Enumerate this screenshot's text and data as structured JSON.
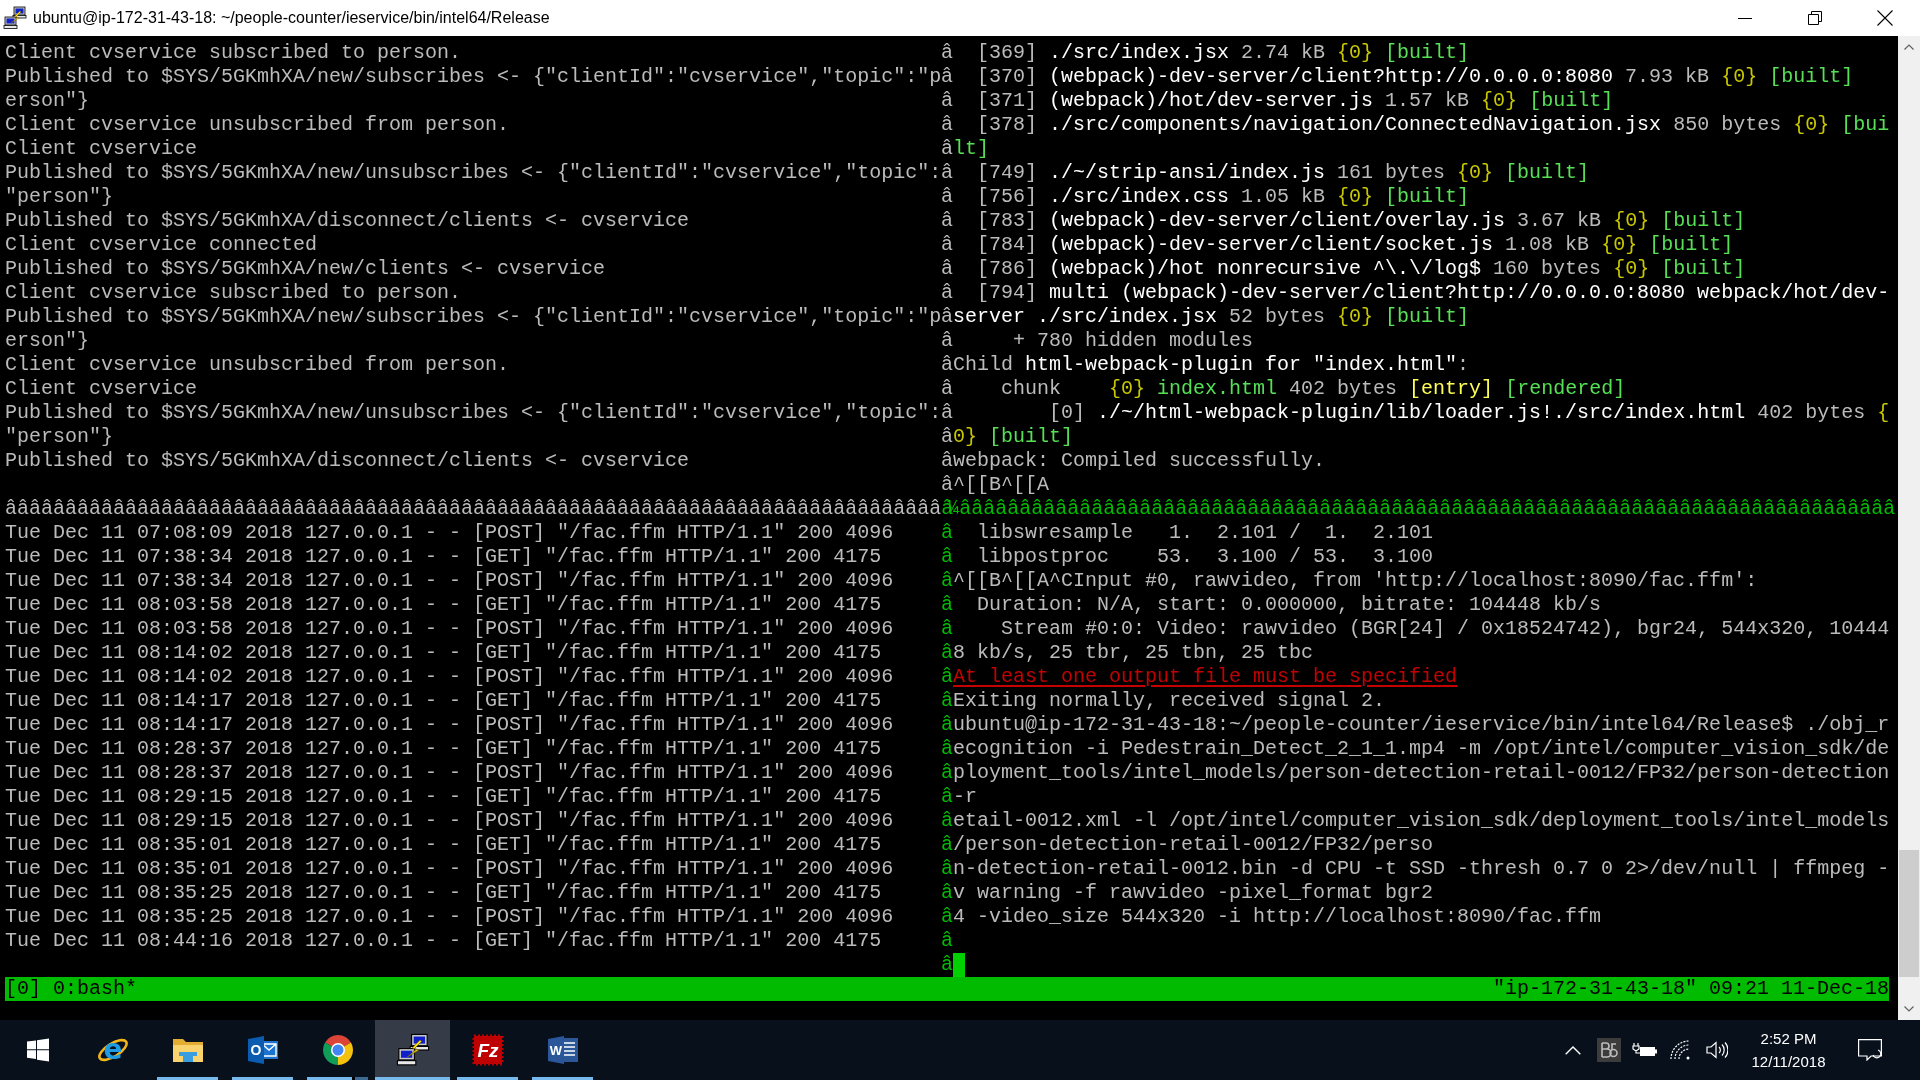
{
  "window": {
    "title": "ubuntu@ip-172-31-43-18: ~/people-counter/ieservice/bin/intel64/Release"
  },
  "terminal": {
    "top": {
      "border_active": false,
      "rows": [
        {
          "left": "Client cvservice subscribed to person.",
          "divider": "â",
          "right": [
            "  [369] ",
            {
              "text": "./src/index.jsx",
              "kind": "module"
            },
            " 2.74 kB ",
            {
              "text": "{0}",
              "kind": "chunk"
            },
            {
              "text": " [built]",
              "kind": "status"
            }
          ]
        },
        {
          "left": "Published to $SYS/5GKmhXA/new/subscribes <- {\"clientId\":\"cvservice\",\"topic\":\"p",
          "divider": "â",
          "right": [
            "  [370] ",
            {
              "text": "(webpack)-dev-server/client?http://0.0.0.0:8080",
              "kind": "module"
            },
            " 7.93 kB ",
            {
              "text": "{0}",
              "kind": "chunk"
            },
            {
              "text": " [built]",
              "kind": "status"
            }
          ]
        },
        {
          "left": "erson\"}",
          "divider": "â",
          "right": [
            "  [371] ",
            {
              "text": "(webpack)/hot/dev-server.js",
              "kind": "module"
            },
            " 1.57 kB ",
            {
              "text": "{0}",
              "kind": "chunk"
            },
            {
              "text": " [built]",
              "kind": "status"
            }
          ]
        },
        {
          "left": "Client cvservice unsubscribed from person.",
          "divider": "â",
          "right": [
            "  [378] ",
            {
              "text": "./src/components/navigation/ConnectedNavigation.jsx",
              "kind": "module"
            },
            " 850 bytes ",
            {
              "text": "{0}",
              "kind": "chunk"
            },
            {
              "text": " [bui",
              "kind": "status"
            }
          ]
        },
        {
          "left": "Client cvservice",
          "divider": "â",
          "right": [
            {
              "text": "lt]",
              "kind": "status"
            }
          ]
        },
        {
          "left": "Published to $SYS/5GKmhXA/new/unsubscribes <- {\"clientId\":\"cvservice\",\"topic\":",
          "divider": "â",
          "right": [
            "  [749] ",
            {
              "text": "./~/strip-ansi/index.js",
              "kind": "module"
            },
            " 161 bytes ",
            {
              "text": "{0}",
              "kind": "chunk"
            },
            {
              "text": " [built]",
              "kind": "status"
            }
          ]
        },
        {
          "left": "\"person\"}",
          "divider": "â",
          "right": [
            "  [756] ",
            {
              "text": "./src/index.css",
              "kind": "module"
            },
            " 1.05 kB ",
            {
              "text": "{0}",
              "kind": "chunk"
            },
            {
              "text": " [built]",
              "kind": "status"
            }
          ]
        },
        {
          "left": "Published to $SYS/5GKmhXA/disconnect/clients <- cvservice",
          "divider": "â",
          "right": [
            "  [783] ",
            {
              "text": "(webpack)-dev-server/client/overlay.js",
              "kind": "module"
            },
            " 3.67 kB ",
            {
              "text": "{0}",
              "kind": "chunk"
            },
            {
              "text": " [built]",
              "kind": "status"
            }
          ]
        },
        {
          "left": "Client cvservice connected",
          "divider": "â",
          "right": [
            "  [784] ",
            {
              "text": "(webpack)-dev-server/client/socket.js",
              "kind": "module"
            },
            " 1.08 kB ",
            {
              "text": "{0}",
              "kind": "chunk"
            },
            {
              "text": " [built]",
              "kind": "status"
            }
          ]
        },
        {
          "left": "Published to $SYS/5GKmhXA/new/clients <- cvservice",
          "divider": "â",
          "right": [
            "  [786] ",
            {
              "text": "(webpack)/hot nonrecursive ^\\.\\/log$",
              "kind": "module"
            },
            " 160 bytes ",
            {
              "text": "{0}",
              "kind": "chunk"
            },
            {
              "text": " [built]",
              "kind": "status"
            }
          ]
        },
        {
          "left": "Client cvservice subscribed to person.",
          "divider": "â",
          "right": [
            "  [794] ",
            {
              "text": "multi (webpack)-dev-server/client?http://0.0.0.0:8080 webpack/hot/dev-",
              "kind": "module"
            }
          ]
        },
        {
          "left": "Published to $SYS/5GKmhXA/new/subscribes <- {\"clientId\":\"cvservice\",\"topic\":\"p",
          "divider": "â",
          "right": [
            {
              "text": "server ./src/index.jsx",
              "kind": "module"
            },
            " 52 bytes ",
            {
              "text": "{0}",
              "kind": "chunk"
            },
            {
              "text": " [built]",
              "kind": "status"
            }
          ]
        },
        {
          "left": "erson\"}",
          "divider": "â",
          "right": [
            "     + 780 hidden modules"
          ]
        },
        {
          "left": "Client cvservice unsubscribed from person.",
          "divider": "â",
          "right": [
            "Child ",
            {
              "text": "html-webpack-plugin for \"index.html\"",
              "kind": "module"
            },
            ":"
          ]
        },
        {
          "left": "Client cvservice",
          "divider": "â",
          "right": [
            "    chunk    ",
            {
              "text": "{0}",
              "kind": "chunk"
            },
            {
              "text": " index.html",
              "kind": "status"
            },
            " 402 bytes ",
            {
              "text": "[entry]",
              "kind": "tag"
            },
            {
              "text": " [rendered]",
              "kind": "status"
            }
          ]
        },
        {
          "left": "Published to $SYS/5GKmhXA/new/unsubscribes <- {\"clientId\":\"cvservice\",\"topic\":",
          "divider": "â",
          "right": [
            "        [0] ",
            {
              "text": "./~/html-webpack-plugin/lib/loader.js!./src/index.html",
              "kind": "module"
            },
            " 402 bytes ",
            {
              "text": "{",
              "kind": "chunk"
            }
          ]
        },
        {
          "left": "\"person\"}",
          "divider": "â",
          "right": [
            {
              "text": "0}",
              "kind": "chunk"
            },
            {
              "text": " [built]",
              "kind": "status"
            }
          ]
        },
        {
          "left": "Published to $SYS/5GKmhXA/disconnect/clients <- cvservice",
          "divider": "â",
          "right": [
            "webpack: Compiled successfully."
          ]
        },
        {
          "divider": "â",
          "right": [
            "^[[B^[[A"
          ]
        }
      ]
    },
    "border_row": {
      "left": "ââââââââââââââââââââââââââââââââââââââââââââââââââââââââââââââââââââââââââââââ",
      "left_active": false,
      "junction": "â¼",
      "right": "ââââââââââââââââââââââââââââââââââââââââââââââââââââââââââââââââââââââââââââââ",
      "right_active": true
    },
    "bottom": {
      "border_active": true,
      "rows": [
        {
          "left": "Tue Dec 11 07:08:09 2018 127.0.0.1 - - [POST] \"/fac.ffm HTTP/1.1\" 200 4096",
          "divider": "â",
          "right": [
            "  libswresample   1.  2.101 /  1.  2.101"
          ]
        },
        {
          "left": "Tue Dec 11 07:38:34 2018 127.0.0.1 - - [GET] \"/fac.ffm HTTP/1.1\" 200 4175",
          "divider": "â",
          "right": [
            "  libpostproc    53.  3.100 / 53.  3.100"
          ]
        },
        {
          "left": "Tue Dec 11 07:38:34 2018 127.0.0.1 - - [POST] \"/fac.ffm HTTP/1.1\" 200 4096",
          "divider": "â",
          "right": [
            "^[[B^[[A^CInput #0, rawvideo, from 'http://localhost:8090/fac.ffm':"
          ]
        },
        {
          "left": "Tue Dec 11 08:03:58 2018 127.0.0.1 - - [GET] \"/fac.ffm HTTP/1.1\" 200 4175",
          "divider": "â",
          "right": [
            "  Duration: N/A, start: 0.000000, bitrate: 104448 kb/s"
          ]
        },
        {
          "left": "Tue Dec 11 08:03:58 2018 127.0.0.1 - - [POST] \"/fac.ffm HTTP/1.1\" 200 4096",
          "divider": "â",
          "right": [
            "    Stream #0:0: Video: rawvideo (BGR[24] / 0x18524742), bgr24, 544x320, 10444"
          ]
        },
        {
          "left": "Tue Dec 11 08:14:02 2018 127.0.0.1 - - [GET] \"/fac.ffm HTTP/1.1\" 200 4175",
          "divider": "â",
          "right": [
            "8 kb/s, 25 tbr, 25 tbn, 25 tbc"
          ]
        },
        {
          "left": "Tue Dec 11 08:14:02 2018 127.0.0.1 - - [POST] \"/fac.ffm HTTP/1.1\" 200 4096",
          "divider": "â",
          "right": [
            {
              "text": "At least one output file must be specified",
              "kind": "error"
            }
          ]
        },
        {
          "left": "Tue Dec 11 08:14:17 2018 127.0.0.1 - - [GET] \"/fac.ffm HTTP/1.1\" 200 4175",
          "divider": "â",
          "right": [
            "Exiting normally, received signal 2."
          ]
        },
        {
          "left": "Tue Dec 11 08:14:17 2018 127.0.0.1 - - [POST] \"/fac.ffm HTTP/1.1\" 200 4096",
          "divider": "â",
          "right": [
            "ubuntu@ip-172-31-43-18:~/people-counter/ieservice/bin/intel64/Release$ ./obj_r"
          ]
        },
        {
          "left": "Tue Dec 11 08:28:37 2018 127.0.0.1 - - [GET] \"/fac.ffm HTTP/1.1\" 200 4175",
          "divider": "â",
          "right": [
            "ecognition -i Pedestrain_Detect_2_1_1.mp4 -m /opt/intel/computer_vision_sdk/de"
          ]
        },
        {
          "left": "Tue Dec 11 08:28:37 2018 127.0.0.1 - - [POST] \"/fac.ffm HTTP/1.1\" 200 4096",
          "divider": "â",
          "right": [
            "ployment_tools/intel_models/person-detection-retail-0012/FP32/person-detection"
          ]
        },
        {
          "left": "Tue Dec 11 08:29:15 2018 127.0.0.1 - - [GET] \"/fac.ffm HTTP/1.1\" 200 4175",
          "divider": "â",
          "right": [
            "-r"
          ]
        },
        {
          "left": "Tue Dec 11 08:29:15 2018 127.0.0.1 - - [POST] \"/fac.ffm HTTP/1.1\" 200 4096",
          "divider": "â",
          "right": [
            "etail-0012.xml -l /opt/intel/computer_vision_sdk/deployment_tools/intel_models"
          ]
        },
        {
          "left": "Tue Dec 11 08:35:01 2018 127.0.0.1 - - [GET] \"/fac.ffm HTTP/1.1\" 200 4175",
          "divider": "â",
          "right": [
            "/person-detection-retail-0012/FP32/perso"
          ]
        },
        {
          "left": "Tue Dec 11 08:35:01 2018 127.0.0.1 - - [POST] \"/fac.ffm HTTP/1.1\" 200 4096",
          "divider": "â",
          "right": [
            "n-detection-retail-0012.bin -d CPU -t SSD -thresh 0.7 0 2>/dev/null | ffmpeg -"
          ]
        },
        {
          "left": "Tue Dec 11 08:35:25 2018 127.0.0.1 - - [GET] \"/fac.ffm HTTP/1.1\" 200 4175",
          "divider": "â",
          "right": [
            "v warning -f rawvideo -pixel_format bgr2"
          ]
        },
        {
          "left": "Tue Dec 11 08:35:25 2018 127.0.0.1 - - [POST] \"/fac.ffm HTTP/1.1\" 200 4096",
          "divider": "â",
          "right": [
            "4 -video_size 544x320 -i http://localhost:8090/fac.ffm"
          ]
        },
        {
          "left": "Tue Dec 11 08:44:16 2018 127.0.0.1 - - [GET] \"/fac.ffm HTTP/1.1\" 200 4175",
          "divider": "â"
        },
        {
          "divider": "â",
          "cursor": true
        }
      ]
    },
    "status_bar": {
      "left": "[0] 0:bash*",
      "right": "\"ip-172-31-43-18\" 09:21 11-Dec-18"
    }
  },
  "taskbar": {
    "apps": [
      {
        "kind": "e-globe",
        "letter": "e",
        "running": false,
        "selected": false
      },
      {
        "kind": "folder",
        "running": true,
        "selected": false,
        "stacked": false
      },
      {
        "kind": "mail",
        "letter": "O",
        "running": true,
        "selected": false,
        "stacked": false
      },
      {
        "kind": "tricolor-circle",
        "running": true,
        "selected": false,
        "stacked": true
      },
      {
        "kind": "computers",
        "running": true,
        "selected": true,
        "stacked": false
      },
      {
        "kind": "perforated-tile",
        "letter": "Fz",
        "running": true,
        "selected": false,
        "stacked": false
      },
      {
        "kind": "document",
        "letter": "W",
        "running": true,
        "selected": false,
        "stacked": false
      }
    ],
    "clock": {
      "time": "2:52 PM",
      "date": "12/11/2018"
    }
  }
}
